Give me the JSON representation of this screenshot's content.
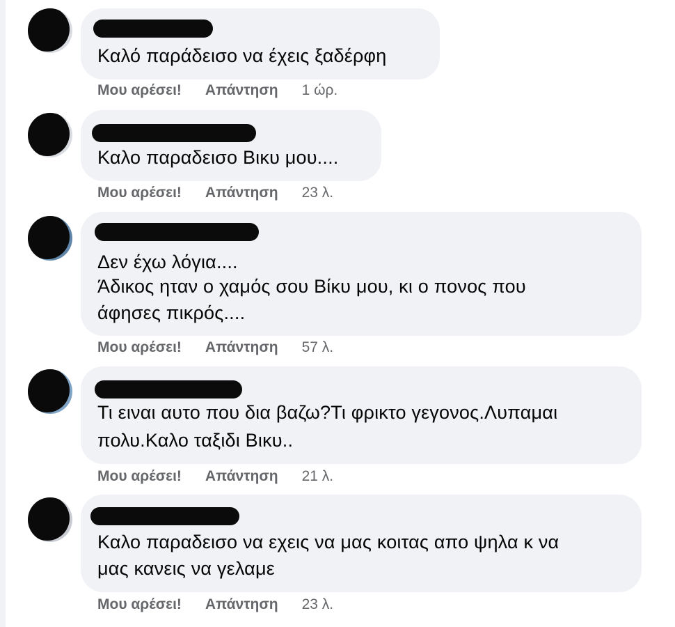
{
  "comments": [
    {
      "text_lines": [
        "Καλό παράδεισο να έχεις ξαδέρφη"
      ],
      "like": "Μου αρέσει!",
      "reply": "Απάντηση",
      "time": "1 ώρ."
    },
    {
      "text_lines": [
        "Καλο παραδεισο Βικυ μου...."
      ],
      "like": "Μου αρέσει!",
      "reply": "Απάντηση",
      "time": "23 λ."
    },
    {
      "text_lines": [
        "Δεν έχω λόγια....",
        "Άδικος ηταν ο χαμός σου Βίκυ μου, κι ο πονος που",
        "άφησες πικρός...."
      ],
      "like": "Μου αρέσει!",
      "reply": "Απάντηση",
      "time": "57 λ."
    },
    {
      "text_lines": [
        "Τι ειναι αυτο που δια βαζω?Τι φρικτο γεγονος.Λυπαμαι",
        "πολυ.Καλο ταξιδι Βικυ.."
      ],
      "like": "Μου αρέσει!",
      "reply": "Απάντηση",
      "time": "21 λ."
    },
    {
      "text_lines": [
        "Καλο παραδεισο να εχεις να μας κοιτας απο ψηλα κ να",
        "μας κανεις να γελαμε"
      ],
      "like": "Μου αρέσει!",
      "reply": "Απάντηση",
      "time": "23 λ."
    }
  ]
}
